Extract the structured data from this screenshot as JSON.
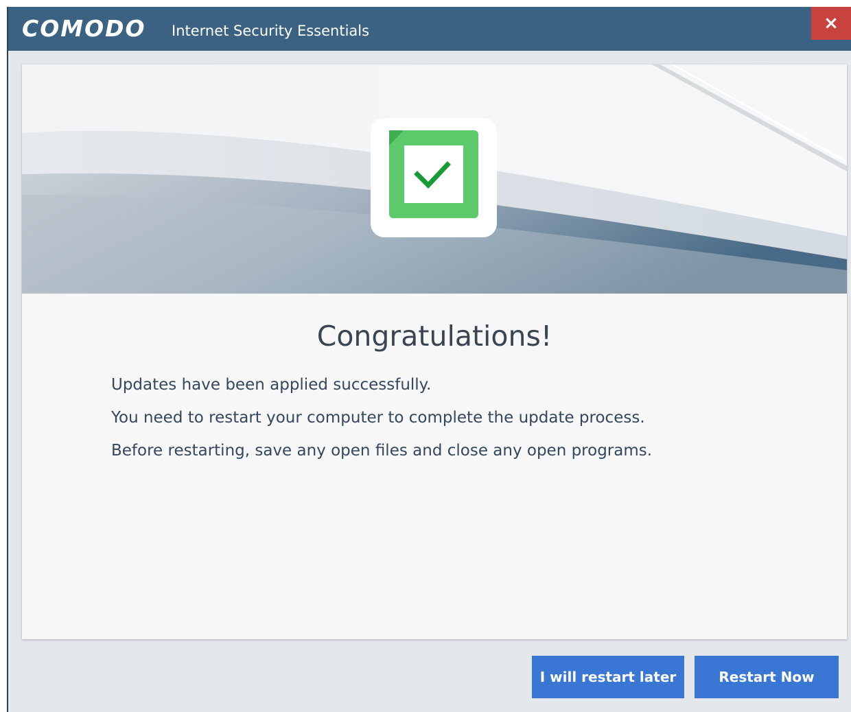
{
  "window": {
    "brand": "COMODO",
    "product": "Internet Security Essentials",
    "close_label": "×"
  },
  "content": {
    "heading": "Congratulations!",
    "lines": [
      "Updates have been applied successfully.",
      "You need to restart your computer to complete the update process.",
      "Before restarting, save any open files and close any open programs."
    ]
  },
  "buttons": {
    "later_label": "I will restart later",
    "now_label": "Restart Now"
  },
  "icons": {
    "app_icon": "green-checkmark-icon",
    "close_icon": "close-icon"
  },
  "colors": {
    "titlebar": "#3b6282",
    "close": "#c8433f",
    "button": "#3a77d4",
    "check_green": "#5cc96b"
  }
}
